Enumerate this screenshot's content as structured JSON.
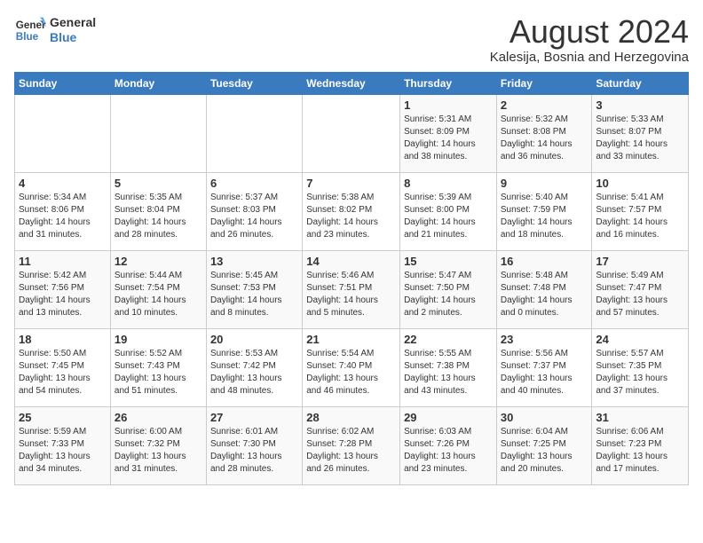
{
  "header": {
    "logo_line1": "General",
    "logo_line2": "Blue",
    "title": "August 2024",
    "subtitle": "Kalesija, Bosnia and Herzegovina"
  },
  "weekdays": [
    "Sunday",
    "Monday",
    "Tuesday",
    "Wednesday",
    "Thursday",
    "Friday",
    "Saturday"
  ],
  "weeks": [
    [
      {
        "day": "",
        "info": ""
      },
      {
        "day": "",
        "info": ""
      },
      {
        "day": "",
        "info": ""
      },
      {
        "day": "",
        "info": ""
      },
      {
        "day": "1",
        "info": "Sunrise: 5:31 AM\nSunset: 8:09 PM\nDaylight: 14 hours\nand 38 minutes."
      },
      {
        "day": "2",
        "info": "Sunrise: 5:32 AM\nSunset: 8:08 PM\nDaylight: 14 hours\nand 36 minutes."
      },
      {
        "day": "3",
        "info": "Sunrise: 5:33 AM\nSunset: 8:07 PM\nDaylight: 14 hours\nand 33 minutes."
      }
    ],
    [
      {
        "day": "4",
        "info": "Sunrise: 5:34 AM\nSunset: 8:06 PM\nDaylight: 14 hours\nand 31 minutes."
      },
      {
        "day": "5",
        "info": "Sunrise: 5:35 AM\nSunset: 8:04 PM\nDaylight: 14 hours\nand 28 minutes."
      },
      {
        "day": "6",
        "info": "Sunrise: 5:37 AM\nSunset: 8:03 PM\nDaylight: 14 hours\nand 26 minutes."
      },
      {
        "day": "7",
        "info": "Sunrise: 5:38 AM\nSunset: 8:02 PM\nDaylight: 14 hours\nand 23 minutes."
      },
      {
        "day": "8",
        "info": "Sunrise: 5:39 AM\nSunset: 8:00 PM\nDaylight: 14 hours\nand 21 minutes."
      },
      {
        "day": "9",
        "info": "Sunrise: 5:40 AM\nSunset: 7:59 PM\nDaylight: 14 hours\nand 18 minutes."
      },
      {
        "day": "10",
        "info": "Sunrise: 5:41 AM\nSunset: 7:57 PM\nDaylight: 14 hours\nand 16 minutes."
      }
    ],
    [
      {
        "day": "11",
        "info": "Sunrise: 5:42 AM\nSunset: 7:56 PM\nDaylight: 14 hours\nand 13 minutes."
      },
      {
        "day": "12",
        "info": "Sunrise: 5:44 AM\nSunset: 7:54 PM\nDaylight: 14 hours\nand 10 minutes."
      },
      {
        "day": "13",
        "info": "Sunrise: 5:45 AM\nSunset: 7:53 PM\nDaylight: 14 hours\nand 8 minutes."
      },
      {
        "day": "14",
        "info": "Sunrise: 5:46 AM\nSunset: 7:51 PM\nDaylight: 14 hours\nand 5 minutes."
      },
      {
        "day": "15",
        "info": "Sunrise: 5:47 AM\nSunset: 7:50 PM\nDaylight: 14 hours\nand 2 minutes."
      },
      {
        "day": "16",
        "info": "Sunrise: 5:48 AM\nSunset: 7:48 PM\nDaylight: 14 hours\nand 0 minutes."
      },
      {
        "day": "17",
        "info": "Sunrise: 5:49 AM\nSunset: 7:47 PM\nDaylight: 13 hours\nand 57 minutes."
      }
    ],
    [
      {
        "day": "18",
        "info": "Sunrise: 5:50 AM\nSunset: 7:45 PM\nDaylight: 13 hours\nand 54 minutes."
      },
      {
        "day": "19",
        "info": "Sunrise: 5:52 AM\nSunset: 7:43 PM\nDaylight: 13 hours\nand 51 minutes."
      },
      {
        "day": "20",
        "info": "Sunrise: 5:53 AM\nSunset: 7:42 PM\nDaylight: 13 hours\nand 48 minutes."
      },
      {
        "day": "21",
        "info": "Sunrise: 5:54 AM\nSunset: 7:40 PM\nDaylight: 13 hours\nand 46 minutes."
      },
      {
        "day": "22",
        "info": "Sunrise: 5:55 AM\nSunset: 7:38 PM\nDaylight: 13 hours\nand 43 minutes."
      },
      {
        "day": "23",
        "info": "Sunrise: 5:56 AM\nSunset: 7:37 PM\nDaylight: 13 hours\nand 40 minutes."
      },
      {
        "day": "24",
        "info": "Sunrise: 5:57 AM\nSunset: 7:35 PM\nDaylight: 13 hours\nand 37 minutes."
      }
    ],
    [
      {
        "day": "25",
        "info": "Sunrise: 5:59 AM\nSunset: 7:33 PM\nDaylight: 13 hours\nand 34 minutes."
      },
      {
        "day": "26",
        "info": "Sunrise: 6:00 AM\nSunset: 7:32 PM\nDaylight: 13 hours\nand 31 minutes."
      },
      {
        "day": "27",
        "info": "Sunrise: 6:01 AM\nSunset: 7:30 PM\nDaylight: 13 hours\nand 28 minutes."
      },
      {
        "day": "28",
        "info": "Sunrise: 6:02 AM\nSunset: 7:28 PM\nDaylight: 13 hours\nand 26 minutes."
      },
      {
        "day": "29",
        "info": "Sunrise: 6:03 AM\nSunset: 7:26 PM\nDaylight: 13 hours\nand 23 minutes."
      },
      {
        "day": "30",
        "info": "Sunrise: 6:04 AM\nSunset: 7:25 PM\nDaylight: 13 hours\nand 20 minutes."
      },
      {
        "day": "31",
        "info": "Sunrise: 6:06 AM\nSunset: 7:23 PM\nDaylight: 13 hours\nand 17 minutes."
      }
    ]
  ]
}
